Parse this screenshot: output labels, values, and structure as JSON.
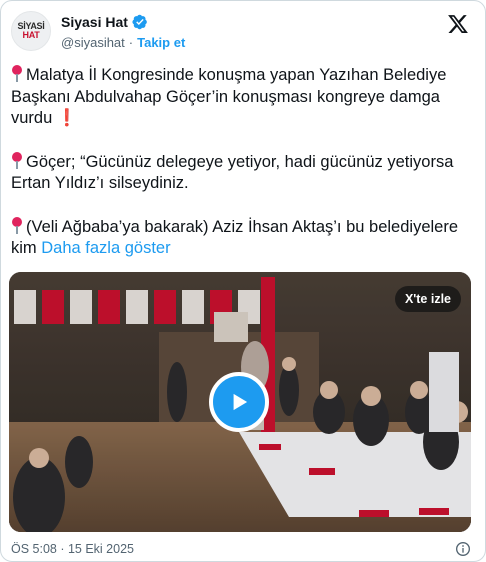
{
  "account": {
    "avatar_line1": "SİYASİ",
    "avatar_line2": "HAT",
    "name": "Siyasi Hat",
    "handle": "@siyasihat",
    "separator": "·",
    "follow_label": "Takip et"
  },
  "icons": {
    "verified": "verified-badge-icon",
    "brand": "x-logo-icon",
    "pin": "round-pushpin-emoji",
    "exclamation": "red-exclamation-emoji",
    "play": "play-icon",
    "info": "info-icon"
  },
  "tweet": {
    "para1": "Malatya İl Kongresinde konuşma yapan Yazıhan Belediye Başkanı Abdulvahap Göçer’in konuşması kongreye damga vurdu",
    "para1_mark": "❗",
    "para2": "Göçer; “Gücünüz delegeye yetiyor, hadi gücünüz yetiyorsa Ertan Yıldız’ı silseydiniz.",
    "para3": "(Veli Ağbaba’ya bakarak) Aziz İhsan Aktaş’ı bu belediyelere kim",
    "show_more": "Daha fazla göster"
  },
  "media": {
    "watch_on_x": "X'te izle"
  },
  "footer": {
    "timestamp": "ÖS 5:08 · 15 Eki 2025"
  },
  "colors": {
    "accent": "#1d9bf0",
    "text": "#0f1419",
    "secondary": "#536471",
    "pin": "#e0245e"
  }
}
